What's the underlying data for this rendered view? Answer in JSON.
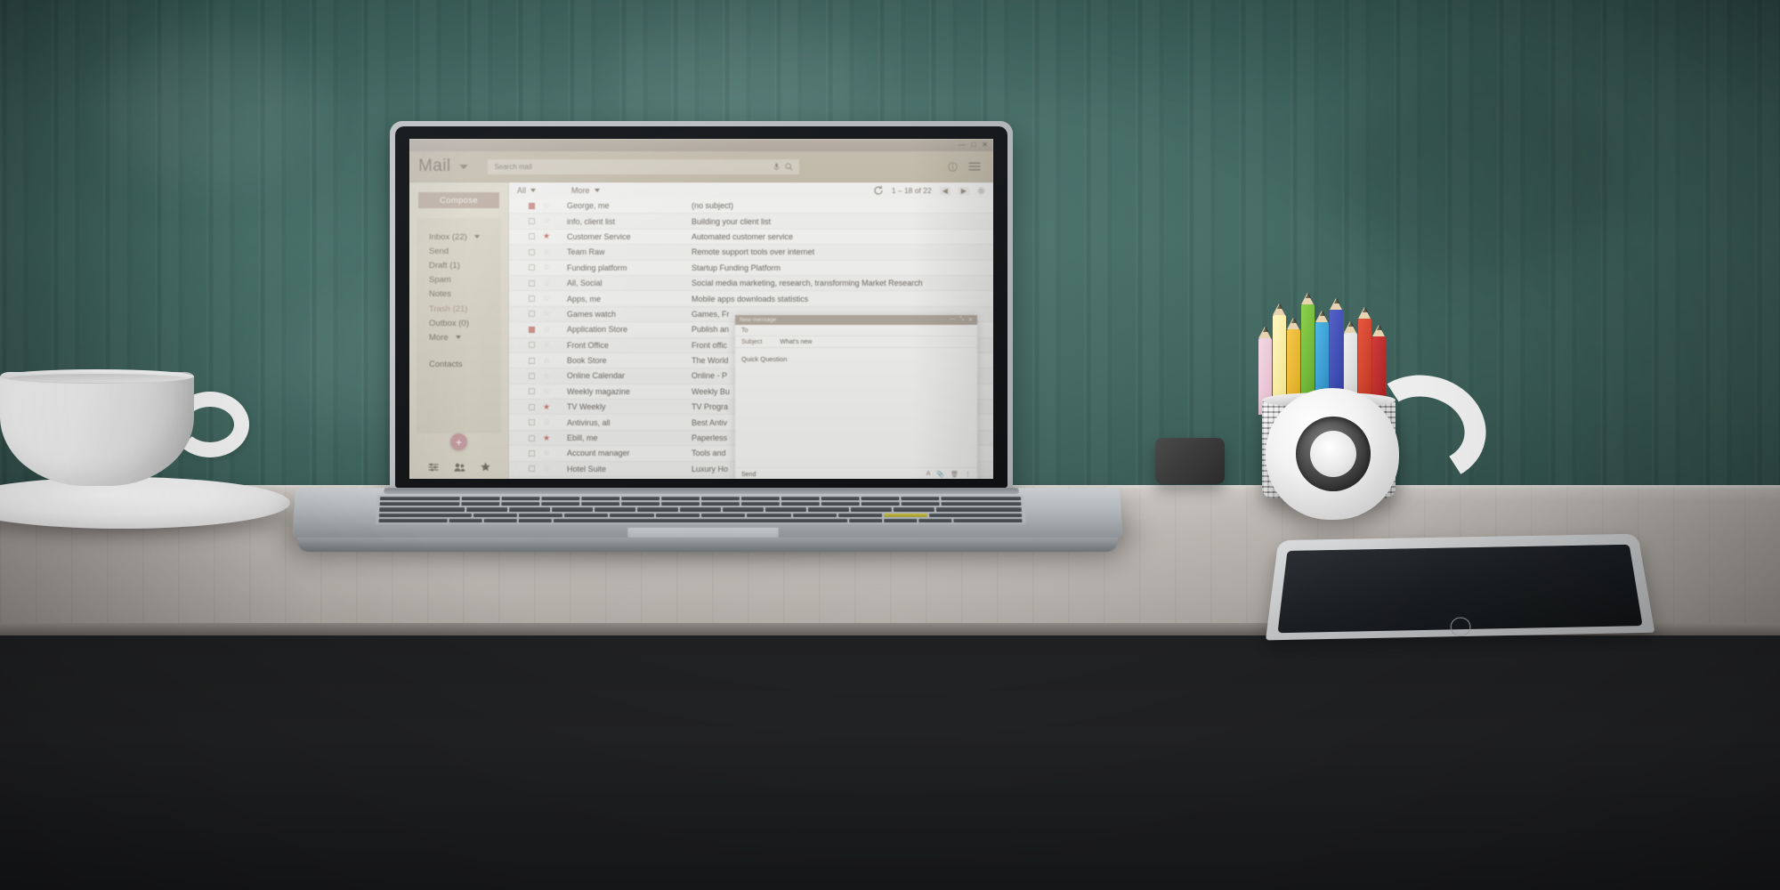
{
  "scene": {
    "description": "Laptop on wooden desk showing mail client",
    "wall_color": "#477069",
    "desk_color": "#c2bcb6",
    "floor_color": "#1f2022"
  },
  "window": {
    "minimize_label": "—",
    "maximize_label": "□",
    "close_label": "✕"
  },
  "header": {
    "brand": "Mail",
    "brand_dropdown_icon": "chevron-down-icon",
    "search_placeholder": "Search mail",
    "mic_icon": "microphone-icon",
    "search_icon": "search-icon",
    "info_icon": "info-circle-icon",
    "menu_icon": "hamburger-menu-icon"
  },
  "sidebar": {
    "compose_label": "Compose",
    "items": [
      {
        "label": "Inbox (22)",
        "has_caret": true
      },
      {
        "label": "Send",
        "has_caret": false
      },
      {
        "label": "Draft (1)",
        "has_caret": false
      },
      {
        "label": "Spam",
        "has_caret": false
      },
      {
        "label": "Notes",
        "has_caret": false
      },
      {
        "label": "Trash (21)",
        "has_caret": false,
        "highlight": true
      },
      {
        "label": "Outbox (0)",
        "has_caret": false
      },
      {
        "label": "More",
        "has_caret": true
      }
    ],
    "contacts_label": "Contacts",
    "fab_label": "+",
    "tools": [
      "sliders-icon",
      "people-icon",
      "star-icon"
    ]
  },
  "toolbar": {
    "select_all_label": "All",
    "more_label": "More",
    "refresh_icon": "refresh-icon",
    "page_range": "1 – 18 of 22",
    "prev_label": "◀",
    "next_label": "▶",
    "settings_icon": "gear-icon"
  },
  "emails": [
    {
      "sender": "George, me",
      "subject": "(no subject)",
      "checked": true,
      "starred": false
    },
    {
      "sender": "info, client list",
      "subject": "Building your client list",
      "checked": false,
      "starred": false
    },
    {
      "sender": "Customer Service",
      "subject": "Automated customer service",
      "checked": false,
      "starred": true
    },
    {
      "sender": "Team Raw",
      "subject": "Remote support tools over internet",
      "checked": false,
      "starred": false
    },
    {
      "sender": "Funding platform",
      "subject": "Startup Funding Platform",
      "checked": false,
      "starred": false
    },
    {
      "sender": "All, Social",
      "subject": "Social media marketing, research, transforming Market Research",
      "checked": false,
      "starred": false
    },
    {
      "sender": "Apps, me",
      "subject": "Mobile apps downloads statistics",
      "checked": false,
      "starred": false
    },
    {
      "sender": "Games watch",
      "subject": "Games, Fr",
      "checked": false,
      "starred": false
    },
    {
      "sender": "Application Store",
      "subject": "Publish an",
      "checked": true,
      "starred": false
    },
    {
      "sender": "Front Office",
      "subject": "Front offic",
      "checked": false,
      "starred": false
    },
    {
      "sender": "Book Store",
      "subject": "The World",
      "checked": false,
      "starred": false
    },
    {
      "sender": "Online Calendar",
      "subject": "Online - P",
      "checked": false,
      "starred": false
    },
    {
      "sender": "Weekly magazine",
      "subject": "Weekly Bu",
      "checked": false,
      "starred": false
    },
    {
      "sender": "TV Weekly",
      "subject": "TV Progra",
      "checked": false,
      "starred": true
    },
    {
      "sender": "Antivirus, all",
      "subject": "Best Antiv",
      "checked": false,
      "starred": false
    },
    {
      "sender": "Ebill, me",
      "subject": "Paperless",
      "checked": false,
      "starred": true
    },
    {
      "sender": "Account manager",
      "subject": "Tools and",
      "checked": false,
      "starred": false
    },
    {
      "sender": "Hotel Suite",
      "subject": "Luxury Ho",
      "checked": false,
      "starred": false
    }
  ],
  "compose": {
    "title": "New message",
    "minimize_label": "—",
    "expand_label": "⤡",
    "close_label": "✕",
    "to_label": "To",
    "to_value": "",
    "subject_label": "Subject",
    "subject_value": "What's new",
    "body_text": "Quick Question",
    "send_label": "Send",
    "format_icon": "format-icon",
    "attach_icon": "attach-icon",
    "trash_icon": "trash-icon",
    "more_icon": "more-options-icon"
  },
  "colors": {
    "accent": "#b5a69a",
    "sidebar_bg": "#d9d6c6",
    "header_bg": "#bdb5a4",
    "unread_marker": "#c98b86",
    "star_on": "#c4726c",
    "trash_text": "#a98d83"
  }
}
